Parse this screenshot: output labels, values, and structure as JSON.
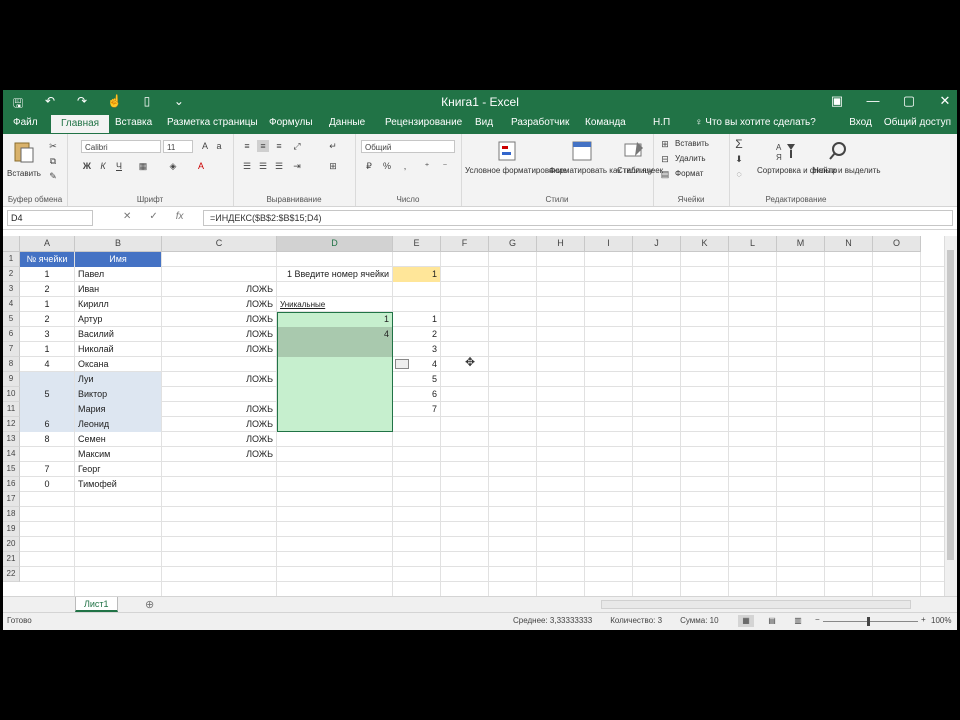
{
  "window": {
    "title": "Книга1 - Excel"
  },
  "qat": {
    "save": "🖫",
    "undo": "↶",
    "redo": "↷",
    "touch": "☝",
    "new": "▯",
    "more": "⌄"
  },
  "window_controls": {
    "ribbon_options": "▣",
    "minimize": "—",
    "restore": "▢",
    "close": "✕"
  },
  "tabs": {
    "file": "Файл",
    "home": "Главная",
    "insert": "Вставка",
    "layout": "Разметка страницы",
    "formulas": "Формулы",
    "data": "Данные",
    "review": "Рецензирование",
    "view": "Вид",
    "developer": "Разработчик",
    "team": "Команда",
    "help": "Н.П",
    "tell": "♀ Что вы хотите сделать?",
    "signin": "Вход",
    "share": "Общий доступ"
  },
  "ribbon": {
    "clipboard": {
      "paste": "Вставить",
      "label": "Буфер обмена"
    },
    "font": {
      "name": "Calibri",
      "size": "11",
      "label": "Шрифт"
    },
    "alignment": {
      "label": "Выравнивание"
    },
    "number": {
      "format": "Общий",
      "label": "Число"
    },
    "styles": {
      "conditional": "Условное форматирование",
      "table": "Форматировать как таблицу",
      "cell_styles": "Стили ячеек",
      "label": "Стили"
    },
    "cells": {
      "insert": "Вставить",
      "delete": "Удалить",
      "format": "Формат",
      "label": "Ячейки"
    },
    "editing": {
      "sort": "Сортировка и фильтр",
      "find": "Найти и выделить",
      "label": "Редактирование"
    }
  },
  "formula_bar": {
    "name_box": "D4",
    "formula": "=ИНДЕКС($B$2:$B$15;D4)"
  },
  "grid": {
    "columns": [
      "A",
      "B",
      "C",
      "D",
      "E",
      "F",
      "G",
      "H",
      "I",
      "J",
      "K",
      "L",
      "M",
      "N",
      "O"
    ],
    "rows": [
      "1",
      "2",
      "3",
      "4",
      "5",
      "6",
      "7",
      "8",
      "9",
      "10",
      "11",
      "12",
      "13",
      "14",
      "15",
      "16",
      "17",
      "18",
      "19",
      "20",
      "21",
      "22"
    ],
    "header_a": "№ ячейки",
    "header_b": "Имя",
    "names": [
      "Павел",
      "Иван",
      "Кирилл",
      "Артур",
      "Василий",
      "Николай",
      "Оксана",
      "Луи",
      "Виктор",
      "Мария",
      "Леонид",
      "Семен",
      "Максим",
      "Георг",
      "Тимофей"
    ],
    "nums": [
      "1",
      "2",
      "1",
      "2",
      "3",
      "1",
      "4",
      "",
      "5",
      "",
      "6",
      "8",
      "",
      "7",
      "0"
    ],
    "lozh": [
      "",
      "ЛОЖЬ",
      "ЛОЖЬ",
      "ЛОЖЬ",
      "ЛОЖЬ",
      "ЛОЖЬ",
      "",
      "ЛОЖЬ",
      "",
      "ЛОЖЬ",
      "ЛОЖЬ",
      "ЛОЖЬ",
      "ЛОЖЬ"
    ],
    "prompt": "1 Введите номер ячейки",
    "input_value": "1",
    "unique_label": "Уникальные",
    "side_nums": [
      "1",
      "2",
      "3",
      "4",
      "5",
      "6",
      "7"
    ],
    "d_nums": [
      "1",
      "4",
      "",
      "",
      ""
    ]
  },
  "sheet_tabs": {
    "sheet1": "Лист1",
    "add": "⊕"
  },
  "status": {
    "ready": "Готово",
    "average": "Среднее: 3,33333333",
    "count": "Количество: 3",
    "sum": "Сумма: 10",
    "zoom": "100%"
  }
}
